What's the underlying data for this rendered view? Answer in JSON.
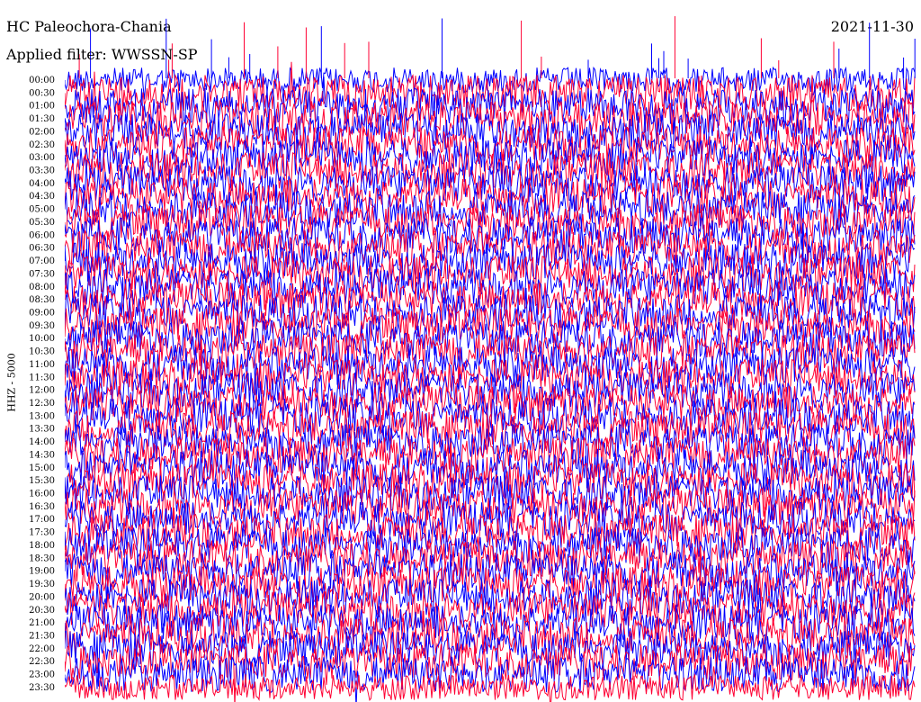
{
  "header": {
    "station": "HC Paleochora-Chania",
    "date": "2021-11-30",
    "filter": "Applied filter: WWSSN-SP"
  },
  "chart_data": {
    "type": "line",
    "title": "HC Paleochora-Chania",
    "date": "2021-11-30",
    "filter": "Applied filter: WWSSN-SP",
    "ylabel": "HHZ - 5000",
    "row_labels": [
      "00:00",
      "00:30",
      "01:00",
      "01:30",
      "02:00",
      "02:30",
      "03:00",
      "03:30",
      "04:00",
      "04:30",
      "05:00",
      "05:30",
      "06:00",
      "06:30",
      "07:00",
      "07:30",
      "08:00",
      "08:30",
      "09:00",
      "09:30",
      "10:00",
      "10:30",
      "11:00",
      "11:30",
      "12:00",
      "12:30",
      "13:00",
      "13:30",
      "14:00",
      "14:30",
      "15:00",
      "15:30",
      "16:00",
      "16:30",
      "17:00",
      "17:30",
      "18:00",
      "18:30",
      "19:00",
      "19:30",
      "20:00",
      "20:30",
      "21:00",
      "21:30",
      "22:00",
      "22:30",
      "23:00",
      "23:30"
    ],
    "trace_colors": [
      "#0000ff",
      "#ff0033"
    ],
    "background": "#ffffff",
    "grid": false
  }
}
